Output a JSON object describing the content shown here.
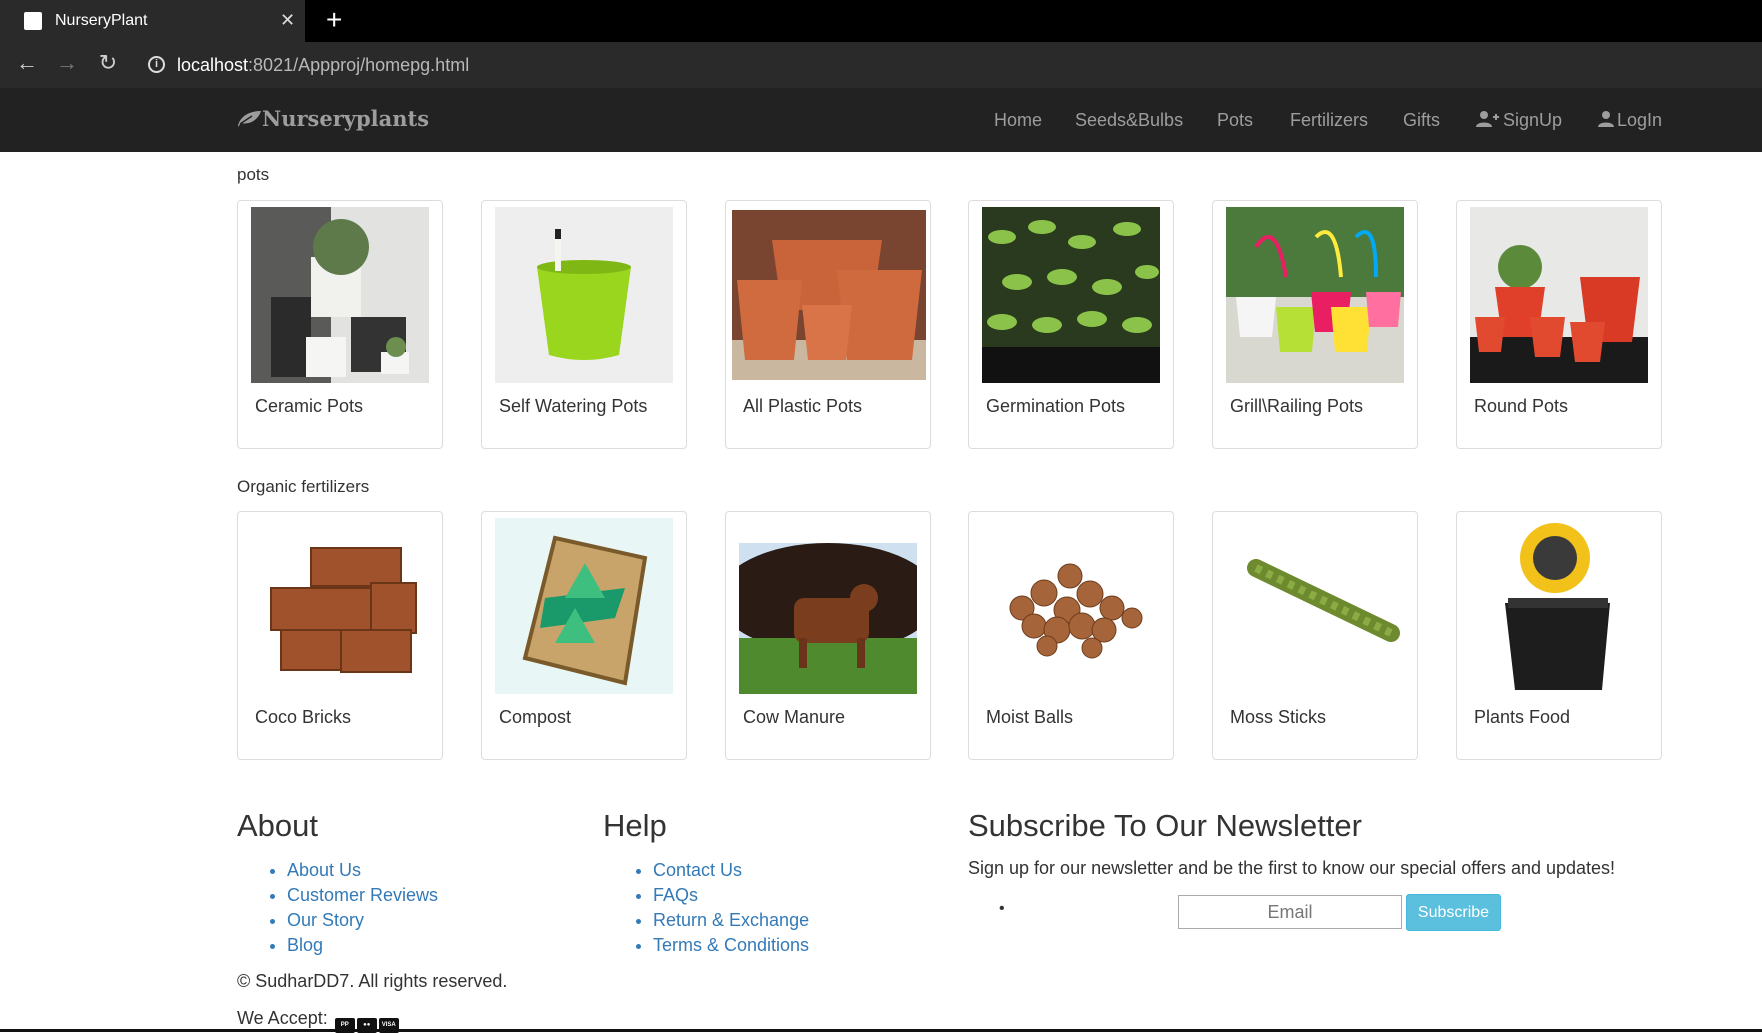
{
  "browser": {
    "tab_title": "NurseryPlant",
    "url_host": "localhost",
    "url_rest": ":8021/Appproj/homepg.html"
  },
  "nav": {
    "brand": "Nurseryplants",
    "links": [
      "Home",
      "Seeds&Bulbs",
      "Pots",
      "Fertilizers",
      "Gifts",
      "SignUp",
      "LogIn"
    ]
  },
  "pots": {
    "label": "pots",
    "items": [
      "Ceramic Pots",
      "Self Watering Pots",
      "All Plastic Pots",
      "Germination Pots",
      "Grill\\Railing Pots",
      "Round Pots"
    ]
  },
  "fertilizers": {
    "label": "Organic fertilizers",
    "items": [
      "Coco Bricks",
      "Compost",
      "Cow Manure",
      "Moist Balls",
      "Moss Sticks",
      "Plants Food"
    ]
  },
  "footer": {
    "about": {
      "heading": "About",
      "links": [
        "About Us",
        "Customer Reviews",
        "Our Story",
        "Blog"
      ]
    },
    "help": {
      "heading": "Help",
      "links": [
        "Contact Us",
        "FAQs",
        "Return & Exchange",
        "Terms & Conditions"
      ]
    },
    "newsletter": {
      "heading": "Subscribe To Our Newsletter",
      "text": "Sign up for our newsletter and be the first to know our special offers and updates!",
      "email_placeholder": "Email",
      "button": "Subscribe"
    },
    "copyright": "© SudharDD7. All rights reserved.",
    "accept": "We Accept:",
    "payment_icons": [
      "paypal-icon",
      "mastercard-icon",
      "visa-icon"
    ]
  },
  "colors": {
    "navbar_bg": "#222222",
    "link": "#337ab7",
    "subscribe_btn": "#5bc0de"
  }
}
